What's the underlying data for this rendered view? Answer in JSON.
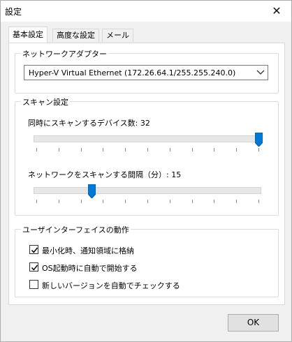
{
  "window": {
    "title": "設定",
    "close_glyph": "✕"
  },
  "tabs": [
    {
      "label": "基本設定",
      "active": true
    },
    {
      "label": "高度な設定",
      "active": false
    },
    {
      "label": "メール",
      "active": false
    }
  ],
  "network_adapter": {
    "label": "ネットワークアダプター",
    "selected": "Hyper-V Virtual Ethernet (172.26.64.1/255.255.240.0)"
  },
  "scan_settings": {
    "label": "スキャン設定",
    "devices_slider": {
      "label": "同時にスキャンするデバイス数: 32",
      "fraction": 1.0
    },
    "interval_slider": {
      "label": "ネットワークをスキャンする間隔（分）: 15",
      "fraction": 0.25
    }
  },
  "ui_behavior": {
    "label": "ユーザインターフェイスの動作",
    "options": [
      {
        "label": "最小化時、通知領域に格納",
        "checked": true
      },
      {
        "label": "OS起動時に自動で開始する",
        "checked": true
      },
      {
        "label": "新しいバージョンを自動でチェックする",
        "checked": false
      }
    ]
  },
  "ok_button": {
    "label": "OK"
  },
  "colors": {
    "accent": "#0078d7",
    "thumb_edge": "#005a9e"
  }
}
